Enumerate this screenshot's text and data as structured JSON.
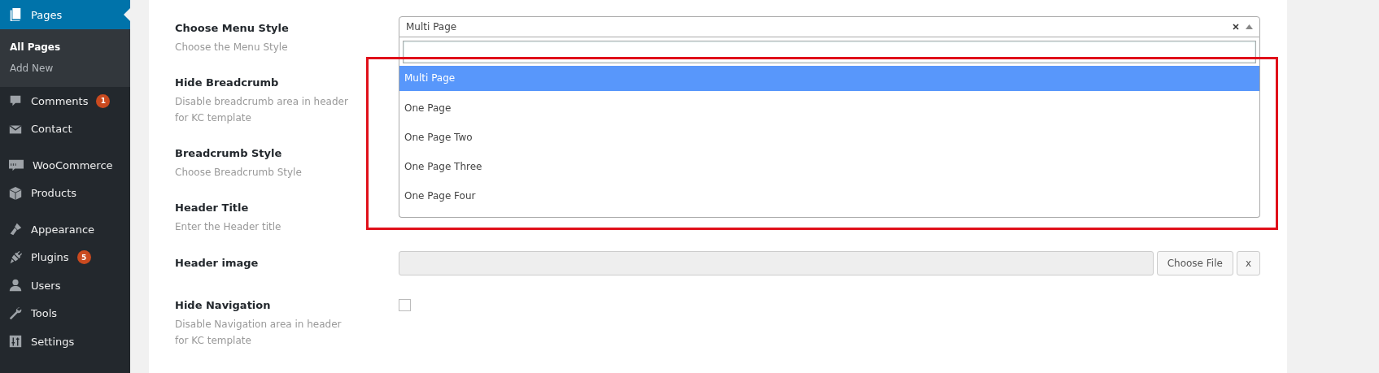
{
  "sidebar": {
    "groups": [
      {
        "items": [
          {
            "label": "Pages",
            "selected": true,
            "children": [
              {
                "label": "All Pages",
                "selected": true
              },
              {
                "label": "Add New",
                "selected": false
              }
            ]
          },
          {
            "label": "Comments",
            "selected": false,
            "badge": "1"
          },
          {
            "label": "Contact",
            "selected": false
          }
        ]
      },
      {
        "items": [
          {
            "label": "WooCommerce",
            "selected": false
          },
          {
            "label": "Products",
            "selected": false
          }
        ]
      },
      {
        "items": [
          {
            "label": "Appearance",
            "selected": false
          },
          {
            "label": "Plugins",
            "selected": false,
            "badge": "5"
          },
          {
            "label": "Users",
            "selected": false
          },
          {
            "label": "Tools",
            "selected": false
          },
          {
            "label": "Settings",
            "selected": false
          }
        ]
      }
    ]
  },
  "form": {
    "fields": [
      {
        "kind": "select",
        "label": "Choose Menu Style",
        "description": "Choose the Menu Style",
        "value": "Multi Page",
        "open": true,
        "options": [
          {
            "label": "Multi Page",
            "selected": true
          },
          {
            "label": "One Page",
            "selected": false
          },
          {
            "label": "One Page Two",
            "selected": false
          },
          {
            "label": "One Page Three",
            "selected": false
          },
          {
            "label": "One Page Four",
            "selected": false
          }
        ]
      },
      {
        "kind": "covered",
        "label": "Hide Breadcrumb",
        "description": "Disable breadcrumb area in header for KC template"
      },
      {
        "kind": "covered",
        "label": "Breadcrumb Style",
        "description": "Choose Breadcrumb Style"
      },
      {
        "kind": "covered",
        "label": "Header Title",
        "description": "Enter the Header title"
      },
      {
        "kind": "file",
        "label": "Header image",
        "button": "Choose File",
        "clear": "x"
      },
      {
        "kind": "checkbox",
        "label": "Hide Navigation",
        "description": "Disable Navigation area in header for KC template",
        "checked": false
      }
    ]
  },
  "annotation": {
    "kind": "highlight"
  }
}
